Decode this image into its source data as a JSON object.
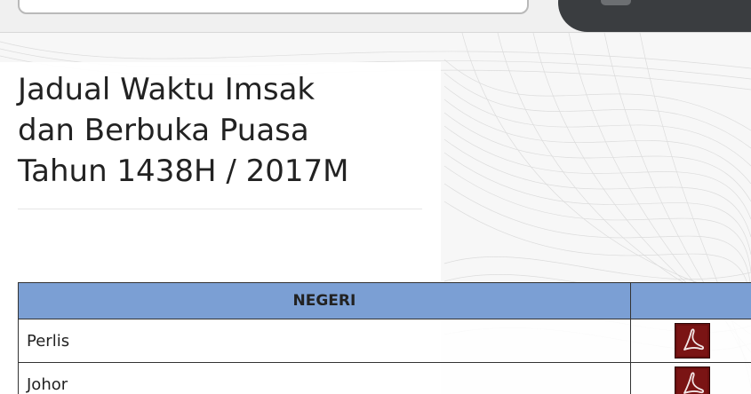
{
  "header": {
    "title_lines": [
      "Jadual Waktu Imsak",
      "dan Berbuka Puasa",
      "Tahun 1438H / 2017M"
    ]
  },
  "table": {
    "headers": [
      "NEGERI",
      ""
    ],
    "rows": [
      {
        "state": "Perlis",
        "icon": "pdf-icon"
      },
      {
        "state": "Johor",
        "icon": "pdf-icon"
      }
    ]
  },
  "colors": {
    "header_bg": "#7b9fd4",
    "icon_bg": "#6b0f0f",
    "text": "#222222"
  }
}
